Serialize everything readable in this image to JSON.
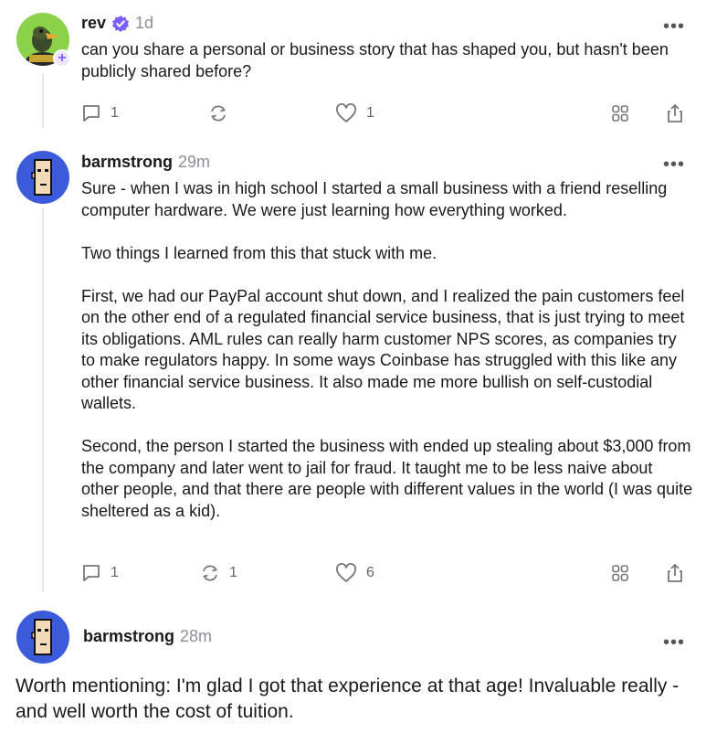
{
  "posts": [
    {
      "username": "rev",
      "time": "1d",
      "text": "can you share a personal or business story that has shaped you, but hasn't been publicly shared before?",
      "comments": "1",
      "reposts": "",
      "likes": "1"
    },
    {
      "username": "barmstrong",
      "time": "29m",
      "text": "Sure - when I was in high school I started a small business with a friend reselling computer hardware. We were just learning how everything worked.\n\nTwo things I learned from this that stuck with me.\n\nFirst, we had our PayPal account shut down, and I realized the pain customers feel on the other end of a regulated financial service business, that is just trying to meet its obligations. AML rules can really harm customer NPS scores, as companies try to make regulators happy. In some ways Coinbase has struggled with this like any other financial service business. It also made me more bullish on self-custodial wallets.\n\nSecond, the person I started the business with ended up stealing about $3,000 from the company and later went to jail for fraud. It taught me to be less naive about other people, and that there are people with different values in the world (I was quite sheltered as a kid).",
      "comments": "1",
      "reposts": "1",
      "likes": "6"
    },
    {
      "username": "barmstrong",
      "time": "28m",
      "text": "Worth mentioning: I'm glad I got that experience at that age! Invaluable really - and well worth the cost of tuition."
    }
  ],
  "icons": {
    "verified": "verified-badge-icon",
    "more": "more-options-icon",
    "comment": "comment-icon",
    "repost": "repost-icon",
    "like": "heart-icon",
    "bookmark": "grid-icon",
    "share": "share-icon"
  },
  "colors": {
    "verified": "#7b61ff",
    "avatar_blue": "#3b5bdb",
    "avatar_green": "#8bd14a",
    "muted": "#8e8e98"
  }
}
